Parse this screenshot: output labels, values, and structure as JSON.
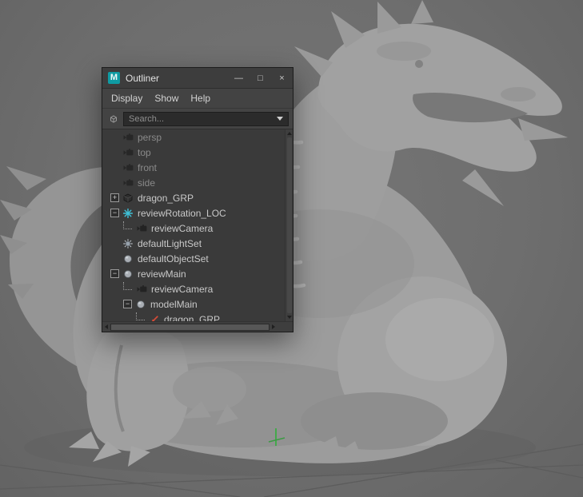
{
  "colors": {
    "viewport_bg": "#6e6e6e",
    "window_bg": "#3a3a3a",
    "titlebar_bg": "#3d3d3d",
    "tree_bg": "#3a3a3a",
    "text": "#c9c9c9",
    "muted_text": "#8a8a8a",
    "maya_teal": "#0f9ba3",
    "locator_cyan": "#3fc1d8",
    "reference_red": "#d14b38",
    "axis_green": "#44a84c"
  },
  "window": {
    "icon_letter": "M",
    "title": "Outliner",
    "minimize_label": "—",
    "maximize_label": "□",
    "close_label": "×"
  },
  "menubar": {
    "items": [
      {
        "label": "Display"
      },
      {
        "label": "Show"
      },
      {
        "label": "Help"
      }
    ]
  },
  "search": {
    "placeholder": "Search..."
  },
  "outliner": {
    "rows": [
      {
        "label": "persp",
        "icon": "camera-icon",
        "level": 0,
        "muted": true
      },
      {
        "label": "top",
        "icon": "camera-icon",
        "level": 0,
        "muted": true
      },
      {
        "label": "front",
        "icon": "camera-icon",
        "level": 0,
        "muted": true
      },
      {
        "label": "side",
        "icon": "camera-icon",
        "level": 0,
        "muted": true
      },
      {
        "label": "dragon_GRP",
        "icon": "transform-icon",
        "level": 0,
        "expander": "+"
      },
      {
        "label": "reviewRotation_LOC",
        "icon": "locator-icon",
        "level": 0,
        "expander": "−"
      },
      {
        "label": "reviewCamera",
        "icon": "camera-icon",
        "level": 1,
        "connector": true
      },
      {
        "label": "defaultLightSet",
        "icon": "light-set-icon",
        "level": 0
      },
      {
        "label": "defaultObjectSet",
        "icon": "object-set-icon",
        "level": 0
      },
      {
        "label": "reviewMain",
        "icon": "object-set-icon",
        "level": 0,
        "expander": "−"
      },
      {
        "label": "reviewCamera",
        "icon": "camera-icon",
        "level": 1,
        "connector": true
      },
      {
        "label": "modelMain",
        "icon": "object-set-icon",
        "level": 1,
        "expander": "−",
        "connector": true
      },
      {
        "label": "dragon_GRP",
        "icon": "reference-icon",
        "level": 2,
        "connector": true
      }
    ]
  }
}
